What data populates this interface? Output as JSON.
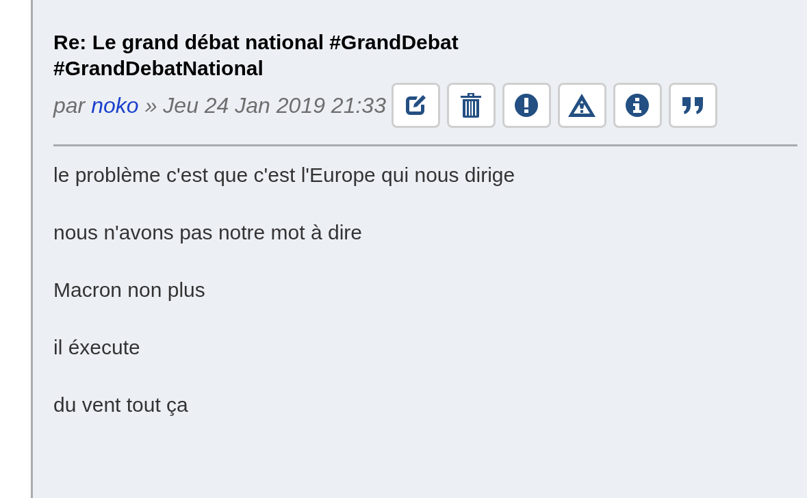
{
  "post": {
    "title": "Re: Le grand débat national #GrandDebat #GrandDebatNational",
    "meta": {
      "prefix": "par",
      "author": "noko",
      "separator": "»",
      "date": "Jeu 24 Jan 2019 21:33"
    },
    "buttons": [
      {
        "kind": "edit"
      },
      {
        "kind": "delete"
      },
      {
        "kind": "report"
      },
      {
        "kind": "warn"
      },
      {
        "kind": "info"
      },
      {
        "kind": "quote"
      }
    ],
    "paragraphs": [
      "le problème c'est que c'est l'Europe qui nous dirige",
      "nous n'avons pas notre mot à dire",
      "Macron non plus",
      "il éxecute",
      "du vent tout ça"
    ]
  }
}
